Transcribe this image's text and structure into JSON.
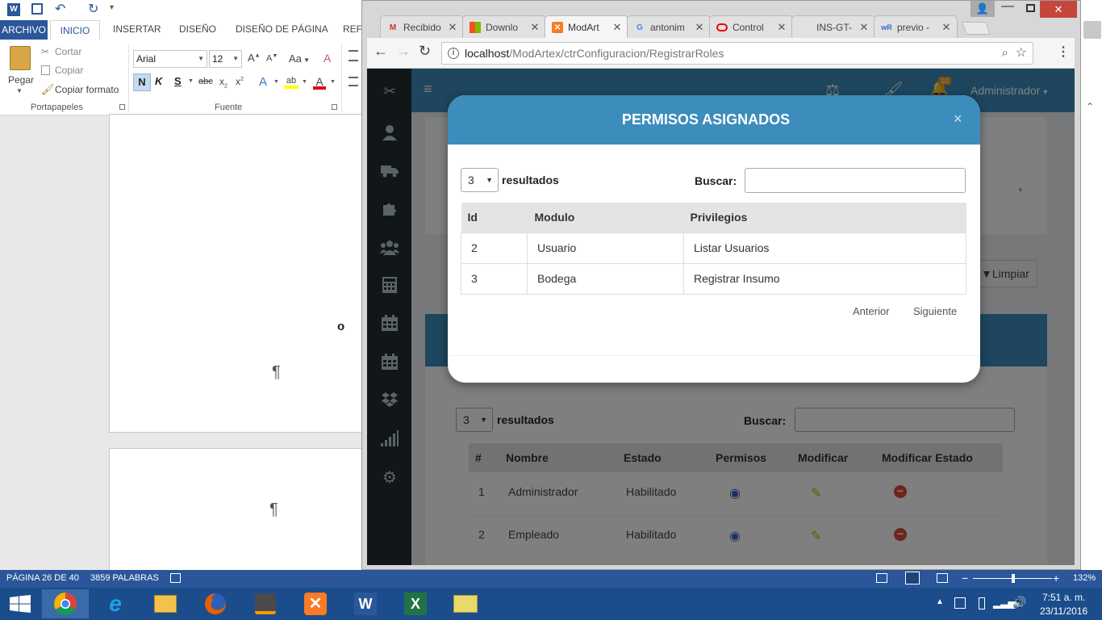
{
  "word": {
    "tabs": [
      "ARCHIVO",
      "INICIO",
      "INSERTAR",
      "DISEÑO",
      "DISEÑO DE PÁGINA",
      "REFE"
    ],
    "clipboard": {
      "paste": "Pegar",
      "cut": "Cortar",
      "copy": "Copiar",
      "format_painter": "Copiar formato",
      "group": "Portapapeles"
    },
    "font": {
      "name": "Arial",
      "size": "12",
      "group": "Fuente",
      "bold": "N",
      "italic": "K",
      "underline": "S",
      "change_case": "Aa"
    },
    "status": {
      "page": "PÁGINA 26 DE 40",
      "words": "3859 PALABRAS",
      "zoom": "132%"
    },
    "doc_marks": {
      "pilcrow": "¶",
      "letter": "o"
    }
  },
  "chrome": {
    "tabs": [
      {
        "label": "Recibido",
        "icon": "gmail-icon"
      },
      {
        "label": "Downlo",
        "icon": "windows-icon"
      },
      {
        "label": "ModArt",
        "icon": "xampp-icon"
      },
      {
        "label": "antonim",
        "icon": "google-icon"
      },
      {
        "label": "Control",
        "icon": "oracle-icon"
      },
      {
        "label": "INS-GT-",
        "icon": ""
      },
      {
        "label": "previo -",
        "icon": "wr-icon"
      }
    ],
    "url_host": "localhost",
    "url_path": "/ModArtex/ctrConfiguracion/RegistrarRoles"
  },
  "app": {
    "user": "Administrador",
    "notif_count": "10",
    "clear_button": "Limpiar",
    "list": {
      "length": "3",
      "length_label": "resultados",
      "search_label": "Buscar:",
      "headers": [
        "#",
        "Nombre",
        "Estado",
        "Permisos",
        "Modificar",
        "Modificar Estado"
      ],
      "rows": [
        {
          "id": "1",
          "name": "Administrador",
          "status": "Habilitado"
        },
        {
          "id": "2",
          "name": "Empleado",
          "status": "Habilitado"
        }
      ]
    }
  },
  "modal": {
    "title": "PERMISOS ASIGNADOS",
    "close": "×",
    "length": "3",
    "length_label": "resultados",
    "search_label": "Buscar:",
    "headers": [
      "Id",
      "Modulo",
      "Privilegios"
    ],
    "rows": [
      {
        "id": "2",
        "module": "Usuario",
        "privilege": "Listar Usuarios"
      },
      {
        "id": "3",
        "module": "Bodega",
        "privilege": "Registrar Insumo"
      }
    ],
    "prev": "Anterior",
    "next": "Siguiente"
  },
  "taskbar": {
    "time": "7:51 a. m.",
    "date": "23/11/2016"
  }
}
